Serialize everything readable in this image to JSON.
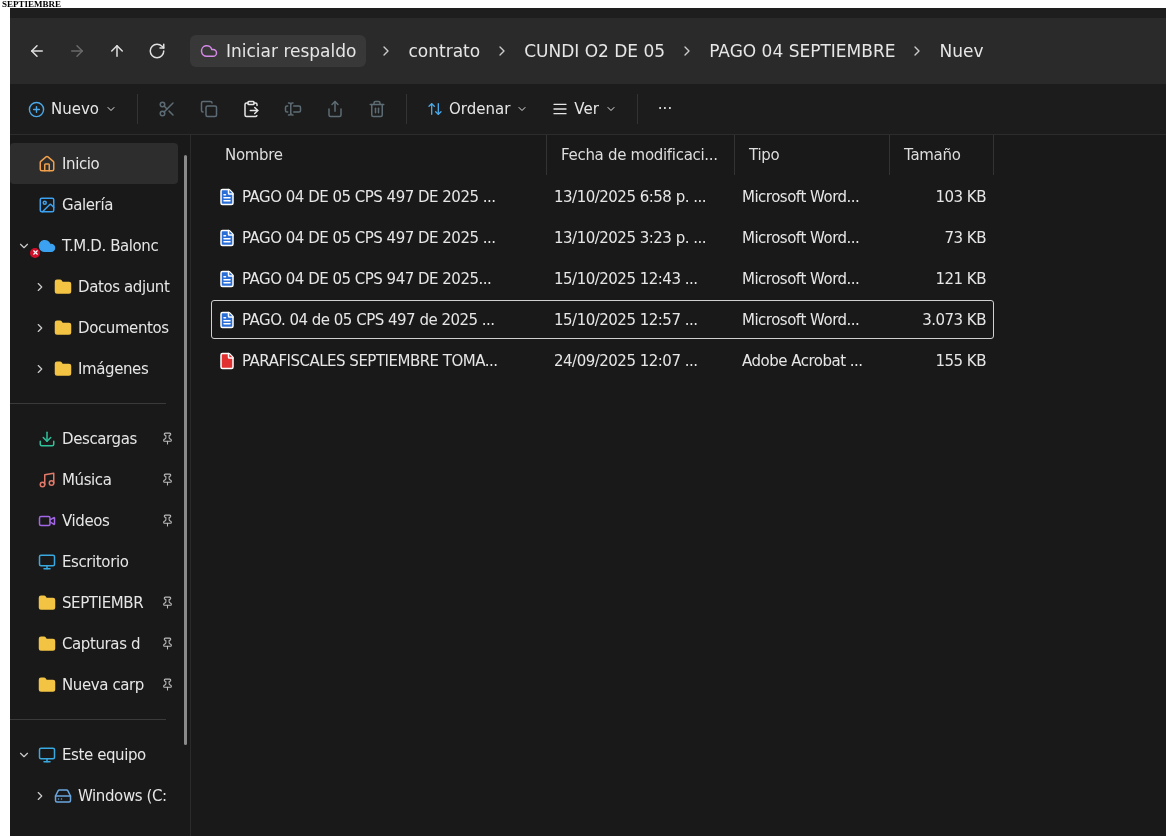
{
  "page_heading": "SEPTIEMBRE",
  "nav": {
    "buttons": [
      {
        "kind": "back",
        "disabled": false
      },
      {
        "kind": "forward",
        "disabled": true
      },
      {
        "kind": "up",
        "disabled": false
      },
      {
        "kind": "refresh",
        "disabled": false
      }
    ],
    "backup": "Iniciar respaldo",
    "breadcrumbs": [
      "contrato",
      "CUNDI O2  DE 05",
      "PAGO 04 SEPTIEMBRE",
      "Nuev"
    ]
  },
  "toolbar": {
    "new": "Nuevo",
    "actions": [
      {
        "kind": "cut",
        "disabled": true
      },
      {
        "kind": "copy",
        "disabled": true
      },
      {
        "kind": "paste",
        "disabled": false
      },
      {
        "kind": "rename",
        "disabled": true
      },
      {
        "kind": "share",
        "disabled": true
      },
      {
        "kind": "delete",
        "disabled": true
      }
    ],
    "sort": "Ordenar",
    "view": "Ver",
    "more": "···"
  },
  "sidebar": {
    "sections": [
      [
        {
          "label": "Inicio",
          "kind": "home",
          "selected": true,
          "pinned": false
        },
        {
          "label": "Galería",
          "kind": "gallery",
          "selected": false,
          "pinned": false
        },
        {
          "label": "T.M.D. Balonc",
          "kind": "cloud",
          "selected": false,
          "pinned": false,
          "expanded": true,
          "error": true,
          "children": [
            {
              "label": "Datos adjunt",
              "kind": "folder",
              "selected": false,
              "pinned": false,
              "expanded": false
            },
            {
              "label": "Documentos",
              "kind": "folder",
              "selected": false,
              "pinned": false,
              "expanded": false
            },
            {
              "label": "Imágenes",
              "kind": "folder",
              "selected": false,
              "pinned": false,
              "expanded": false
            }
          ]
        }
      ],
      [
        {
          "label": "Descargas",
          "kind": "download",
          "selected": false,
          "pinned": true
        },
        {
          "label": "Música",
          "kind": "music",
          "selected": false,
          "pinned": true
        },
        {
          "label": "Videos",
          "kind": "video",
          "selected": false,
          "pinned": true
        },
        {
          "label": "Escritorio",
          "kind": "desktop",
          "selected": false,
          "pinned": false
        },
        {
          "label": "SEPTIEMBR",
          "kind": "folder",
          "selected": false,
          "pinned": true
        },
        {
          "label": "Capturas d",
          "kind": "folder",
          "selected": false,
          "pinned": true
        },
        {
          "label": "Nueva carp",
          "kind": "folder",
          "selected": false,
          "pinned": true
        }
      ],
      [
        {
          "label": "Este equipo",
          "kind": "pc",
          "selected": false,
          "pinned": false,
          "expanded": true,
          "children": [
            {
              "label": "Windows (C:",
              "kind": "drive",
              "selected": false,
              "pinned": false,
              "expanded": false
            }
          ]
        }
      ]
    ]
  },
  "table": {
    "columns": [
      "Nombre",
      "Fecha de modificaci...",
      "Tipo",
      "Tamaño"
    ],
    "rows": [
      {
        "kind": "word",
        "name": "PAGO 04 DE 05 CPS 497 DE 2025 ...",
        "date": "13/10/2025 6:58 p. ...",
        "type": "Microsoft Word...",
        "size": "103 KB",
        "selected": false
      },
      {
        "kind": "word",
        "name": "PAGO 04 DE 05 CPS 497 DE 2025 ...",
        "date": "13/10/2025 3:23 p. ...",
        "type": "Microsoft Word...",
        "size": "73 KB",
        "selected": false
      },
      {
        "kind": "word",
        "name": "PAGO 04 DE 05 CPS 947  DE 2025...",
        "date": "15/10/2025 12:43 ...",
        "type": "Microsoft Word...",
        "size": "121 KB",
        "selected": false
      },
      {
        "kind": "word",
        "name": "PAGO. 04 de 05 CPS 497 de 2025 ...",
        "date": "15/10/2025 12:57 ...",
        "type": "Microsoft Word...",
        "size": "3.073 KB",
        "selected": true
      },
      {
        "kind": "pdf",
        "name": "PARAFISCALES SEPTIEMBRE TOMA...",
        "date": "24/09/2025 12:07 ...",
        "type": "Adobe Acrobat ...",
        "size": "155 KB",
        "selected": false
      }
    ]
  }
}
